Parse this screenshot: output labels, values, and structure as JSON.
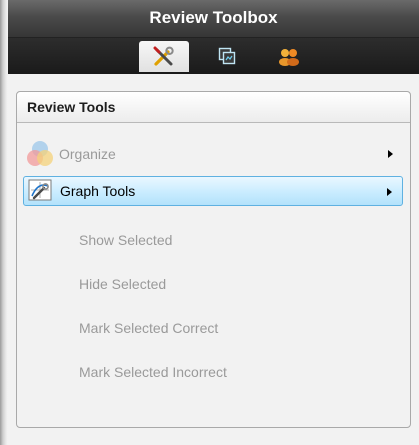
{
  "window": {
    "title": "Review Toolbox"
  },
  "tabs": [
    {
      "icon": "tools-icon",
      "active": true
    },
    {
      "icon": "pages-icon",
      "active": false
    },
    {
      "icon": "students-icon",
      "active": false
    }
  ],
  "review_tools": {
    "header": "Review Tools",
    "items": [
      {
        "label": "Organize",
        "icon": "organize-icon",
        "enabled": false,
        "submenu": true
      },
      {
        "label": "Graph Tools",
        "icon": "graph-tools-icon",
        "enabled": true,
        "selected": true,
        "submenu": true
      },
      {
        "label": "Show Selected",
        "enabled": false
      },
      {
        "label": "Hide Selected",
        "enabled": false
      },
      {
        "label": "Mark Selected Correct",
        "enabled": false
      },
      {
        "label": "Mark Selected Incorrect",
        "enabled": false
      }
    ]
  },
  "colors": {
    "selection_border": "#5fb1e1",
    "selection_fill": "#c9ecff",
    "disabled_text": "#9a9a9a"
  }
}
